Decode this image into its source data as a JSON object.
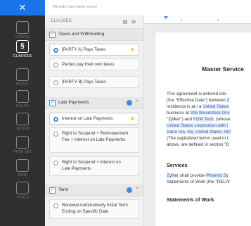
{
  "rail": {
    "close_glyph": "✕",
    "items": [
      {
        "label": "CONFIG",
        "icon": "gear-icon"
      },
      {
        "label": "CLAUSES",
        "icon": "clauses-icon",
        "glyph": "§"
      },
      {
        "label": "PROSE",
        "icon": "prose-icon"
      },
      {
        "label": "FIELDS",
        "icon": "fields-icon"
      },
      {
        "label": "DESIGN",
        "icon": "design-icon"
      },
      {
        "label": "PAGE SET",
        "icon": "page-settings-icon"
      },
      {
        "label": "VIEW",
        "icon": "eye-icon"
      },
      {
        "label": "TOOLS",
        "icon": "tools-icon"
      }
    ]
  },
  "topbar": {
    "status": "All edits have been saved"
  },
  "panel": {
    "title": "CLAUSES",
    "tools": "▤ ⊟",
    "sections": [
      {
        "name": "Taxes and Withholding",
        "options": [
          {
            "text": "[PARTY A] Pays Taxes",
            "selected": true,
            "starred": true
          },
          {
            "text": "Parties pay their own taxes",
            "selected": false,
            "starred": false
          },
          {
            "text": "[PARTY B] Pays Taxes",
            "selected": false,
            "starred": false
          }
        ]
      },
      {
        "name": "Late Payments",
        "options": [
          {
            "text": "Interest on Late Payments",
            "selected": true,
            "starred": true
          },
          {
            "text": "Right to Suspend + Reinstatement Fee + Interest on Late Payments",
            "selected": false,
            "starred": false
          },
          {
            "text": "Right to Suspend + Interest on Late Payments",
            "selected": false,
            "starred": false
          }
        ]
      },
      {
        "name": "Term",
        "options": [
          {
            "text": "Renewal Automatically Initial Term Ending on Specific Date",
            "selected": false,
            "starred": false
          }
        ]
      }
    ]
  },
  "ruler": {
    "ticks": [
      "1",
      "2"
    ]
  },
  "document": {
    "title": "Master Service",
    "para1": {
      "l1": "This agreement is entered into",
      "l2a": "(the \"Effective Date\") between ",
      "l2b": "Z",
      "l3a": "residence is at / a ",
      "l3b": "United States",
      "l4a": "business at ",
      "l4b": "916 Woodstock Driv",
      "l5a": "\"Zylker\") and ",
      "l5b": "FOM Tech",
      "l5c": ", (whose",
      "l6": "United States corporation with i",
      "l7": "Dana Vla, NV, United States 342",
      "l8": "(The capitalized terms used in t",
      "l9": "above, are defined in section \"D"
    },
    "services_heading": "Services",
    "para2": {
      "l1a": "Zylker",
      "l1b": " shall provide ",
      "l1c": "Phoenix Sy",
      "l2": "Statements of Work (the \"DELIV"
    },
    "sow_heading": "Statements of Work"
  },
  "colors": {
    "accent": "#1a73e8",
    "rail": "#2f3031",
    "star": "#f5b400",
    "check": "#3c8dde"
  }
}
